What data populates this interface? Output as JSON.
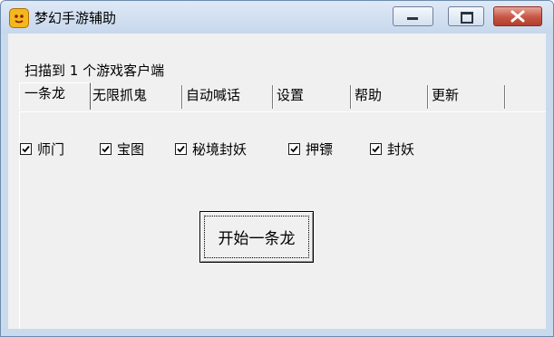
{
  "window": {
    "title": "梦幻手游辅助",
    "controls": {
      "minimize": "minimize-icon",
      "maximize": "maximize-icon",
      "close": "close-icon"
    }
  },
  "status_text": "扫描到 1 个游戏客户端",
  "tabs": [
    {
      "label": "一条龙",
      "active": true
    },
    {
      "label": "无限抓鬼",
      "active": false
    },
    {
      "label": "自动喊话",
      "active": false
    },
    {
      "label": "设置",
      "active": false
    },
    {
      "label": "帮助",
      "active": false
    },
    {
      "label": "更新",
      "active": false
    }
  ],
  "tasks": [
    {
      "label": "师门",
      "checked": true
    },
    {
      "label": "宝图",
      "checked": true
    },
    {
      "label": "秘境封妖",
      "checked": true
    },
    {
      "label": "押镖",
      "checked": true
    },
    {
      "label": "封妖",
      "checked": true
    }
  ],
  "start_button_label": "开始一条龙",
  "colors": {
    "close_button": "#c65544",
    "titlebar": "#c7d7ec",
    "face": "#f0f0f0"
  }
}
